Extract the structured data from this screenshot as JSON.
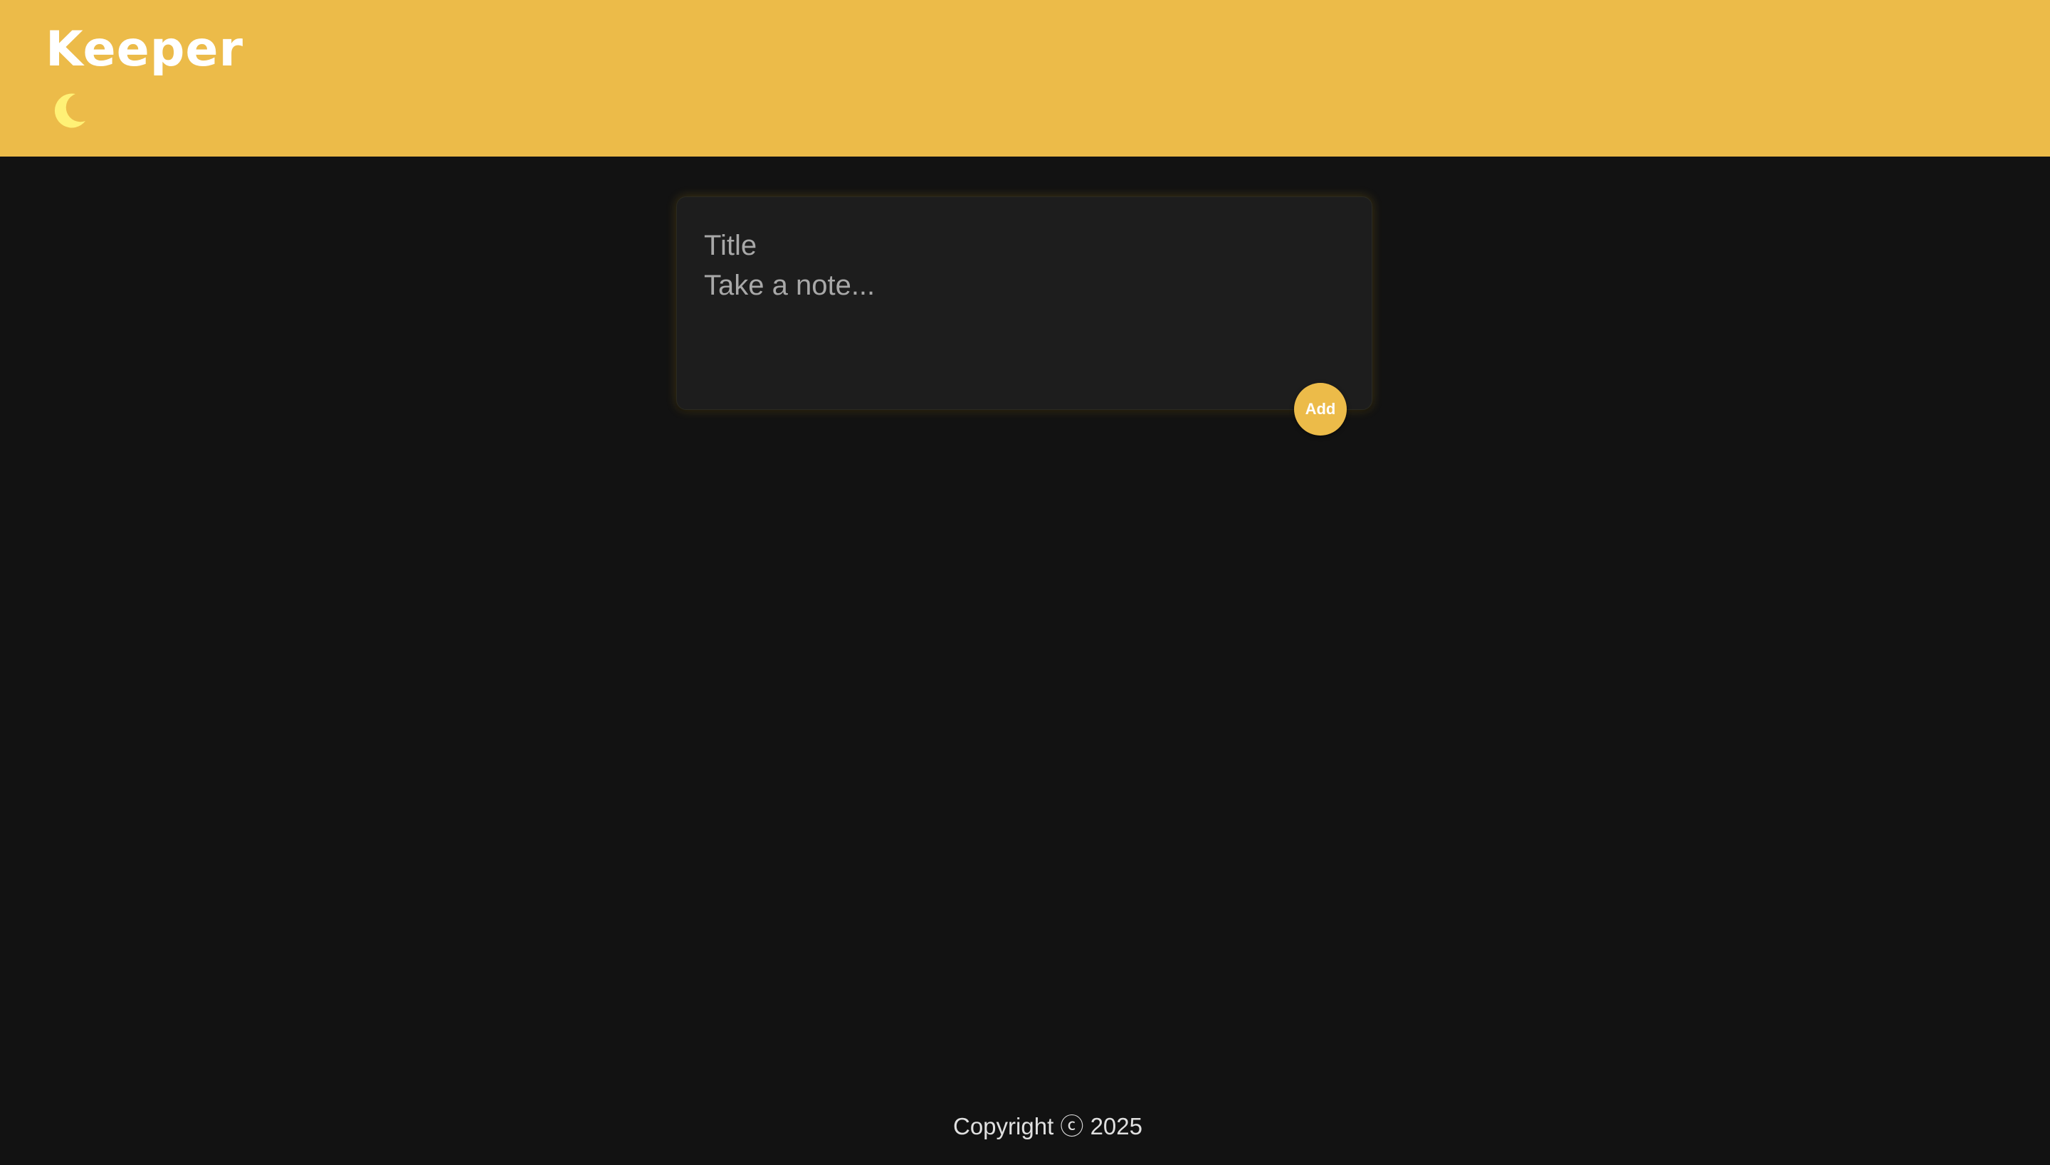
{
  "header": {
    "app_title": "Keeper",
    "theme_toggle_icon": "moon-icon",
    "background_color": "#ecbb49"
  },
  "note_form": {
    "title_placeholder": "Title",
    "title_value": "",
    "content_placeholder": "Take a note...",
    "content_value": "",
    "add_label": "Add",
    "accent_color": "#ecbb49"
  },
  "footer": {
    "copyright": "Copyright ⓒ 2025"
  },
  "colors": {
    "page_background": "#121212",
    "card_background": "#1d1d1d",
    "moon": "#fff176"
  }
}
